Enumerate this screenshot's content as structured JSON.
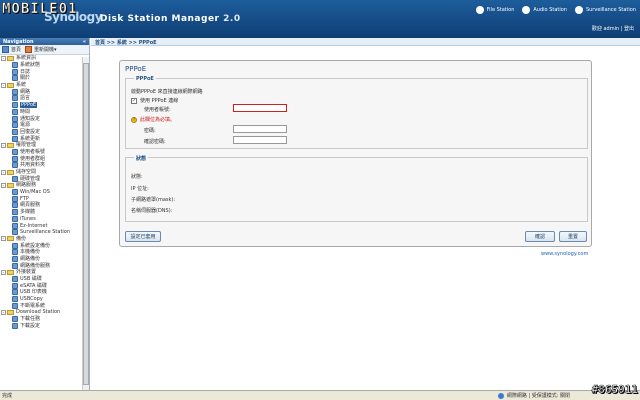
{
  "header": {
    "logo_text": "MOBILE01",
    "logo_mark": "01",
    "syn_text": "Synology",
    "app_name": "Disk Station Manager",
    "app_version": "2.0",
    "links": [
      "File Station",
      "Audio Station",
      "Surveillance Station"
    ],
    "user_bar": "歡迎 admin | 登出"
  },
  "nav": {
    "title": "Navigation",
    "collapse_glyph": "«",
    "home_label": "首頁",
    "rearrange_label": "重新開機▾",
    "tree": [
      {
        "label": "系統資訊",
        "level": 0,
        "type": "folder"
      },
      {
        "label": "系統狀態",
        "level": 1,
        "type": "item"
      },
      {
        "label": "日誌",
        "level": 1,
        "type": "item"
      },
      {
        "label": "關於",
        "level": 1,
        "type": "item"
      },
      {
        "label": "系統",
        "level": 0,
        "type": "folder"
      },
      {
        "label": "網路",
        "level": 1,
        "type": "item"
      },
      {
        "label": "語言",
        "level": 1,
        "type": "item"
      },
      {
        "label": "PPPoE",
        "level": 1,
        "type": "item",
        "selected": true
      },
      {
        "label": "時間",
        "level": 1,
        "type": "item"
      },
      {
        "label": "通知設定",
        "level": 1,
        "type": "item"
      },
      {
        "label": "電源",
        "level": 1,
        "type": "item"
      },
      {
        "label": "回復設定",
        "level": 1,
        "type": "item"
      },
      {
        "label": "系統更新",
        "level": 1,
        "type": "item"
      },
      {
        "label": "權限管理",
        "level": 0,
        "type": "folder"
      },
      {
        "label": "使用者帳號",
        "level": 1,
        "type": "item"
      },
      {
        "label": "使用者群組",
        "level": 1,
        "type": "item"
      },
      {
        "label": "共用資料夾",
        "level": 1,
        "type": "item"
      },
      {
        "label": "儲存空間",
        "level": 0,
        "type": "folder"
      },
      {
        "label": "硬碟管理",
        "level": 1,
        "type": "item"
      },
      {
        "label": "網路服務",
        "level": 0,
        "type": "folder"
      },
      {
        "label": "Win/Mac OS",
        "level": 1,
        "type": "item"
      },
      {
        "label": "FTP",
        "level": 1,
        "type": "item"
      },
      {
        "label": "網頁服務",
        "level": 1,
        "type": "item"
      },
      {
        "label": "多媒體",
        "level": 1,
        "type": "item"
      },
      {
        "label": "iTunes",
        "level": 1,
        "type": "item"
      },
      {
        "label": "Ez-Internet",
        "level": 1,
        "type": "item"
      },
      {
        "label": "Surveillance Station",
        "level": 1,
        "type": "item"
      },
      {
        "label": "備份",
        "level": 0,
        "type": "folder"
      },
      {
        "label": "系統設定備份",
        "level": 1,
        "type": "item"
      },
      {
        "label": "本機備份",
        "level": 1,
        "type": "item"
      },
      {
        "label": "網路備份",
        "level": 1,
        "type": "item"
      },
      {
        "label": "網路備份服務",
        "level": 1,
        "type": "item"
      },
      {
        "label": "外接裝置",
        "level": 0,
        "type": "folder"
      },
      {
        "label": "USB 磁碟",
        "level": 1,
        "type": "item"
      },
      {
        "label": "eSATA 磁碟",
        "level": 1,
        "type": "item"
      },
      {
        "label": "USB 印表機",
        "level": 1,
        "type": "item"
      },
      {
        "label": "USBCopy",
        "level": 1,
        "type": "item"
      },
      {
        "label": "不斷電系統",
        "level": 1,
        "type": "item"
      },
      {
        "label": "Download Station",
        "level": 0,
        "type": "folder"
      },
      {
        "label": "下載任務",
        "level": 1,
        "type": "item"
      },
      {
        "label": "下載設定",
        "level": 1,
        "type": "item"
      }
    ]
  },
  "main": {
    "breadcrumb": "首頁 >> 系統 >> PPPoE",
    "panel_title": "PPPoE",
    "pppoe": {
      "legend": "PPPoE",
      "description": "啟動PPPoE 來直接連線網際網路",
      "enable_label": "使用 PPPoE 連線",
      "enable_checked": true,
      "username_label": "使用者帳號:",
      "required_note": "此欄位為必填。",
      "password_label": "密碼:",
      "confirm_label": "確認密碼:"
    },
    "status": {
      "legend": "狀態",
      "rows": [
        "狀態:",
        "IP 位址:",
        "子網路遮罩(mask):",
        "名稱伺服器(DNS):"
      ]
    },
    "buttons": {
      "wizard": "設定已套用",
      "ok": "確認",
      "reset": "重置"
    },
    "footer_link": "www.synology.com"
  },
  "statusbar": {
    "left": "完成",
    "right": "網際網路 | 受保護模式: 關閉"
  },
  "watermark": "#865911"
}
